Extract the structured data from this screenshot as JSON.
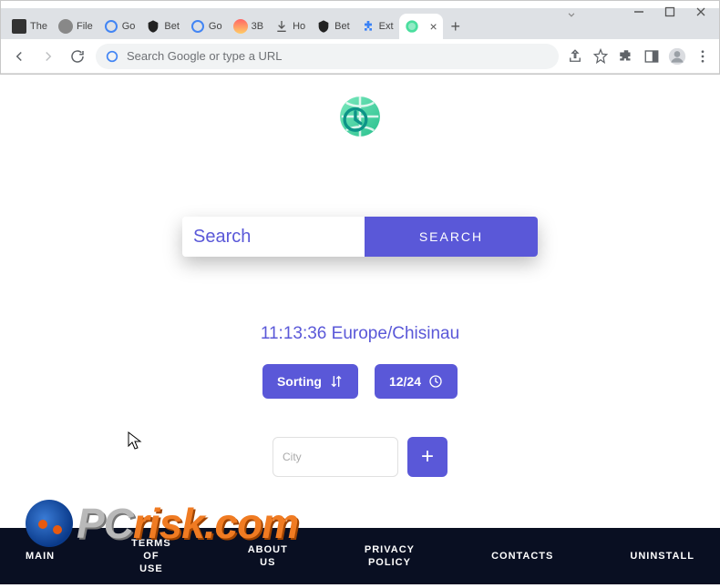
{
  "window": {
    "tabs": [
      {
        "label": "The"
      },
      {
        "label": "File"
      },
      {
        "label": "Go"
      },
      {
        "label": "Bet"
      },
      {
        "label": "Go"
      },
      {
        "label": "3B"
      },
      {
        "label": "Ho"
      },
      {
        "label": "Bet"
      },
      {
        "label": "Ext"
      },
      {
        "label": ""
      }
    ]
  },
  "omnibox": {
    "placeholder": "Search Google or type a URL"
  },
  "page": {
    "search_placeholder": "Search",
    "search_button": "SEARCH",
    "clock_time": "11:13:36",
    "clock_zone": "Europe/Chisinau",
    "sort_label": "Sorting",
    "format_label": "12/24",
    "city_placeholder": "City",
    "add_label": "+"
  },
  "footer": {
    "main": "MAIN",
    "terms": "TERMS\nOF\nUSE",
    "about": "ABOUT\nUS",
    "privacy": "PRIVACY\nPOLICY",
    "contacts": "CONTACTS",
    "uninstall": "UNINSTALL"
  },
  "watermark": {
    "pc": "PC",
    "risk": "risk.com"
  }
}
